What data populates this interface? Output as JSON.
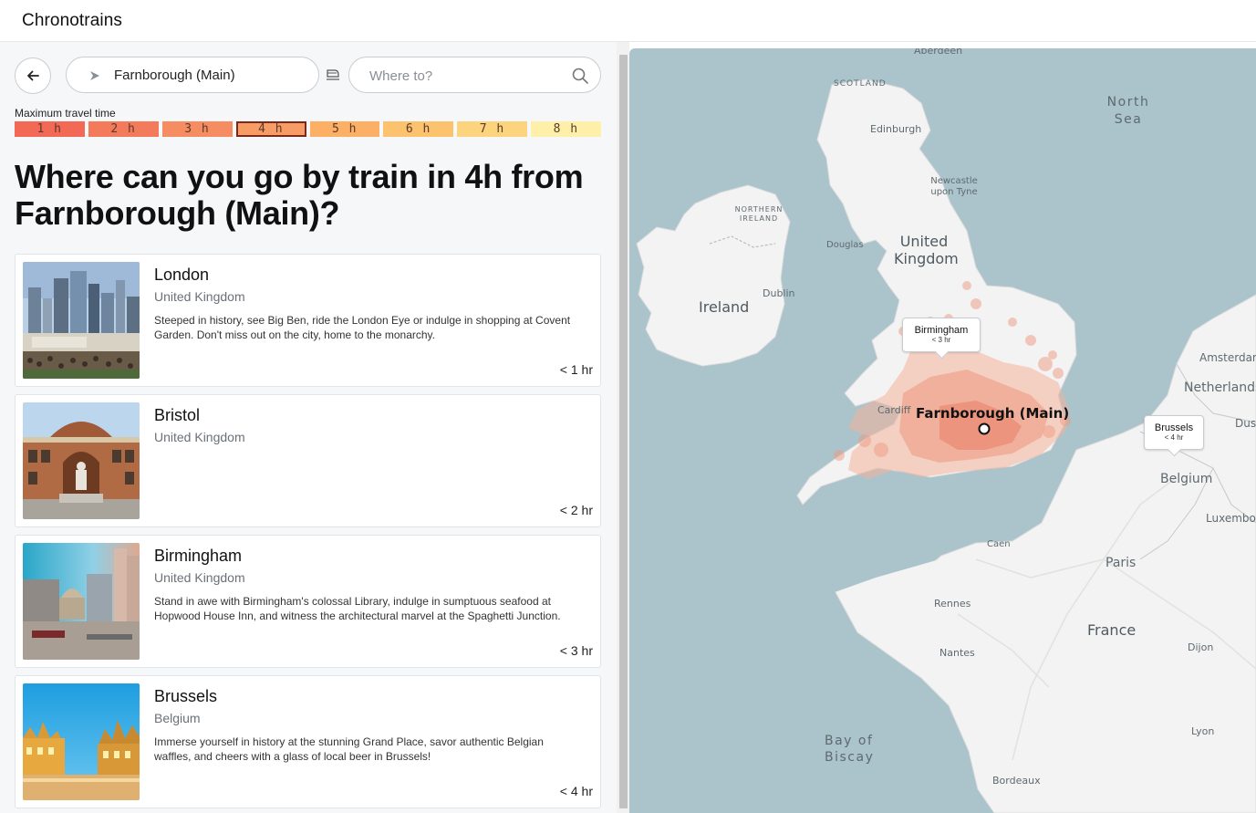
{
  "app": {
    "title": "Chronotrains"
  },
  "search": {
    "from_value": "Farnborough (Main)",
    "to_placeholder": "Where to?"
  },
  "travel_time": {
    "label": "Maximum travel time",
    "selected": "4 h",
    "options": [
      {
        "label": "1 h",
        "color": "#f26a55"
      },
      {
        "label": "2 h",
        "color": "#f47a5c"
      },
      {
        "label": "3 h",
        "color": "#f68c62"
      },
      {
        "label": "4 h",
        "color": "#f89c66"
      },
      {
        "label": "5 h",
        "color": "#fbb066"
      },
      {
        "label": "6 h",
        "color": "#fcc26e"
      },
      {
        "label": "7 h",
        "color": "#fdd47e"
      },
      {
        "label": "8 h",
        "color": "#fef0a8"
      }
    ]
  },
  "headline": "Where can you go by train in 4h from Farnborough (Main)?",
  "destinations": [
    {
      "city": "London",
      "country": "United Kingdom",
      "description": "Steeped in history, see Big Ben, ride the London Eye or indulge in shopping at Covent Garden. Don't miss out on the city, home to the monarchy.",
      "duration": "< 1 hr"
    },
    {
      "city": "Bristol",
      "country": "United Kingdom",
      "description": "",
      "duration": "< 2 hr"
    },
    {
      "city": "Birmingham",
      "country": "United Kingdom",
      "description": "Stand in awe with Birmingham's colossal Library, indulge in sumptuous seafood at Hopwood House Inn, and witness the architectural marvel at the Spaghetti Junction.",
      "duration": "< 3 hr"
    },
    {
      "city": "Brussels",
      "country": "Belgium",
      "description": "Immerse yourself in history at the stunning Grand Place, savor authentic Belgian waffles, and cheers with a glass of local beer in Brussels!",
      "duration": "< 4 hr"
    }
  ],
  "map": {
    "origin_label": "Farnborough (Main)",
    "popups": [
      {
        "name": "Birmingham",
        "time": "< 3 hr"
      },
      {
        "name": "Brussels",
        "time": "< 4 hr"
      }
    ],
    "labels": {
      "aberdeen": "Aberdeen",
      "scotland": "SCOTLAND",
      "north_sea": "North Sea",
      "edinburgh": "Edinburgh",
      "newcastle": "Newcastle upon Tyne",
      "northern_ireland": "NORTHERN IRELAND",
      "douglas": "Douglas",
      "united_kingdom": "United Kingdom",
      "ireland": "Ireland",
      "dublin": "Dublin",
      "amsterdam": "Amsterdam",
      "netherlands": "Netherlands",
      "cardiff": "Cardiff",
      "dus": "Dus",
      "belgium": "Belgium",
      "luxembourg": "Luxembo",
      "caen": "Caen",
      "paris": "Paris",
      "rennes": "Rennes",
      "france": "France",
      "nantes": "Nantes",
      "dijon": "Dijon",
      "bay_of_biscay": "Bay of Biscay",
      "lyon": "Lyon",
      "bordeaux": "Bordeaux"
    }
  }
}
